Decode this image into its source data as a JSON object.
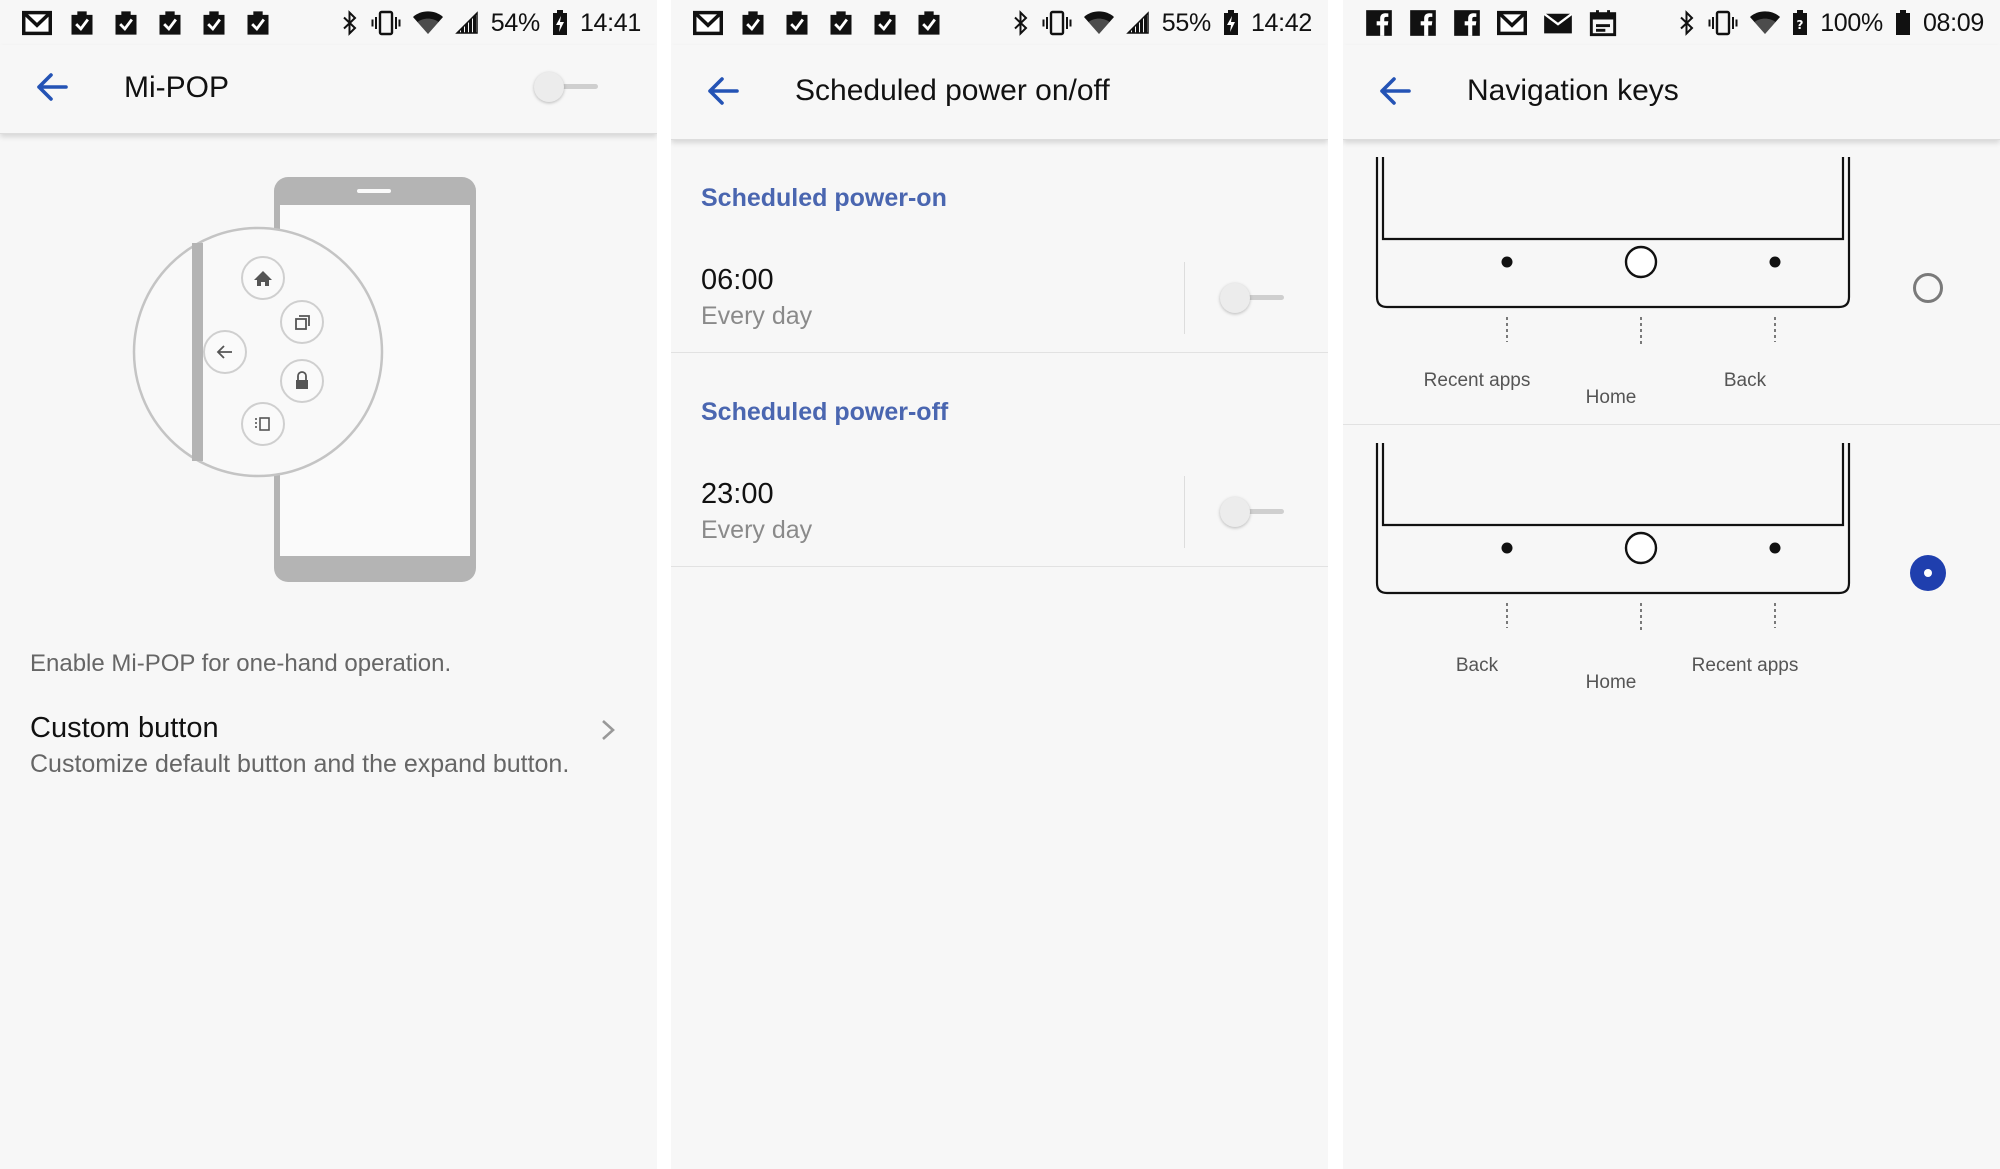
{
  "screens": [
    {
      "status": {
        "battery": "54%",
        "time": "14:41",
        "notif_icons": [
          "gmail-icon",
          "clipboard-check-icon",
          "clipboard-check-icon",
          "clipboard-check-icon",
          "clipboard-check-icon",
          "clipboard-check-icon"
        ]
      },
      "title": "Mi-POP",
      "toggle_on": false,
      "description": "Enable Mi-POP for one-hand operation.",
      "item": {
        "title": "Custom button",
        "subtitle": "Customize default button and the expand button."
      },
      "illustration_icons": [
        "home-icon",
        "recents-icon",
        "back-arrow-icon",
        "lock-icon",
        "screenshot-icon"
      ]
    },
    {
      "status": {
        "battery": "55%",
        "time": "14:42",
        "notif_icons": [
          "gmail-icon",
          "clipboard-check-icon",
          "clipboard-check-icon",
          "clipboard-check-icon",
          "clipboard-check-icon",
          "clipboard-check-icon"
        ]
      },
      "title": "Scheduled power on/off",
      "sections": [
        {
          "header": "Scheduled power-on",
          "time": "06:00",
          "repeat": "Every day",
          "enabled": false
        },
        {
          "header": "Scheduled power-off",
          "time": "23:00",
          "repeat": "Every day",
          "enabled": false
        }
      ]
    },
    {
      "status": {
        "battery": "100%",
        "time": "08:09",
        "notif_icons": [
          "facebook-icon",
          "facebook-icon",
          "facebook-icon",
          "gmail-icon",
          "envelope-icon",
          "calendar-icon"
        ]
      },
      "title": "Navigation keys",
      "options": [
        {
          "left": "Recent apps",
          "center": "Home",
          "right": "Back",
          "selected": false
        },
        {
          "left": "Back",
          "center": "Home",
          "right": "Recent apps",
          "selected": true
        }
      ]
    }
  ],
  "colors": {
    "accent": "#1f3fae",
    "section_header": "#4a66b0",
    "background": "#f7f7f7",
    "divider": "#dddddd"
  }
}
